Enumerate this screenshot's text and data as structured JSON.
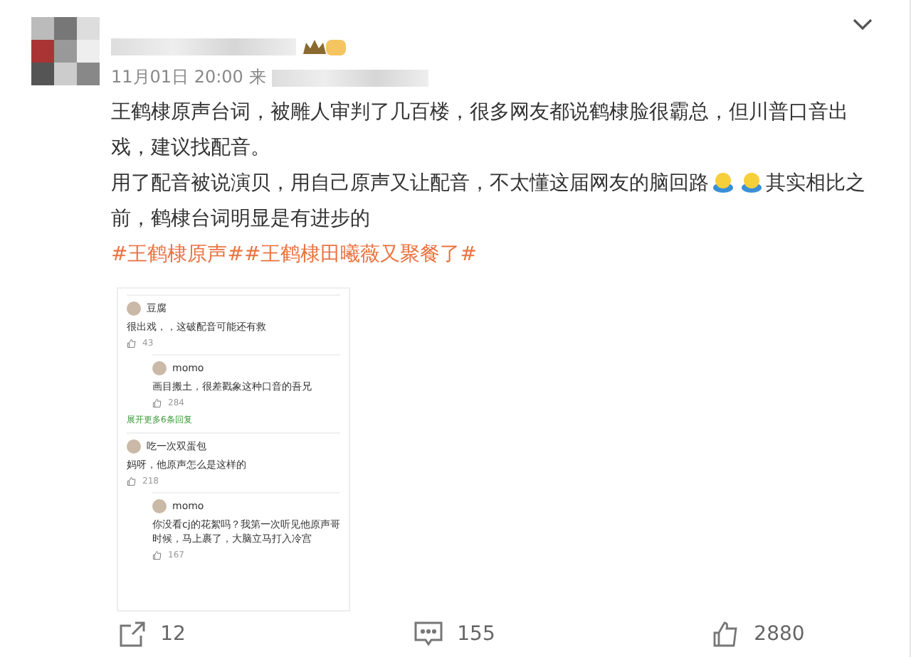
{
  "post": {
    "time": "11月01日 20:00",
    "source_prefix": "来",
    "paragraphs": [
      "王鹤棣原声台词，被雕人审判了几百楼，很多网友都说鹤棣脸很霸总，但川普口音出戏，建议找配音。",
      "用了配音被说演贝，用自己原声又让配音，不太懂这届网友的脑回路"
    ],
    "paragraph_tail": "其实相比之前，鹤棣台词明显是有进步的",
    "hashtags": [
      "#王鹤棣原声#",
      "#王鹤棣田曦薇又聚餐了#"
    ]
  },
  "screenshot": {
    "comments": [
      {
        "author": "豆腐",
        "text": "很出戏，，这破配音可能还有救",
        "likes": "43",
        "reply": false
      },
      {
        "author": "momo",
        "text": "画目搬土，很差戳象这种口音的吾兄",
        "likes": "284",
        "reply": true
      },
      {
        "kind": "more",
        "text": "展开更多6条回复"
      },
      {
        "author": "吃一次双蛋包",
        "text": "妈呀，他原声怎么是这样的",
        "likes": "218",
        "reply": false
      },
      {
        "author": "momo",
        "text": "你没看cj的花絮吗？我第一次听见他原声哥时候，马上裹了，大脑立马打入冷宫",
        "likes": "167",
        "reply": true
      }
    ]
  },
  "actions": [
    {
      "kind": "share",
      "count": "12"
    },
    {
      "kind": "comment",
      "count": "155"
    },
    {
      "kind": "like",
      "count": "2880"
    }
  ]
}
